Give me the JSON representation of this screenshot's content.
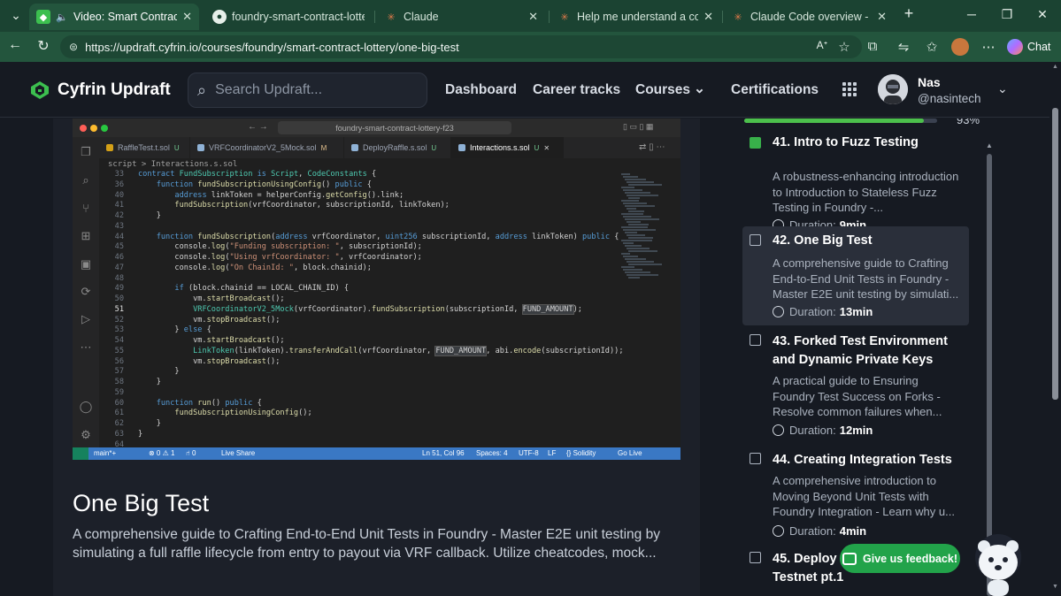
{
  "browser": {
    "tabs": [
      {
        "label": "Video: Smart Contract Lottery",
        "active": true
      },
      {
        "label": "foundry-smart-contract-lottery",
        "active": false
      },
      {
        "label": "Claude",
        "active": false
      },
      {
        "label": "Help me understand a complex",
        "active": false
      },
      {
        "label": "Claude Code overview - Claude",
        "active": false
      }
    ],
    "url": "https://updraft.cyfrin.io/courses/foundry/smart-contract-lottery/one-big-test",
    "chat_label": "Chat"
  },
  "header": {
    "logo_text": "Cyfrin Updraft",
    "search_placeholder": "Search Updraft...",
    "nav": [
      "Dashboard",
      "Career tracks",
      "Courses",
      "Certifications"
    ],
    "user": {
      "name": "Nas",
      "handle": "@nasintech"
    }
  },
  "video": {
    "search_text": "foundry-smart-contract-lottery-f23",
    "tabs": [
      {
        "label": "RaffleTest.t.sol",
        "mark": "U"
      },
      {
        "label": "VRFCoordinatorV2_5Mock.sol",
        "mark": "M"
      },
      {
        "label": "DeployRaffle.s.sol",
        "mark": "U"
      },
      {
        "label": "Interactions.s.sol",
        "mark": "U"
      }
    ],
    "breadcrumb": "script  >  Interactions.s.sol",
    "code_lines": [
      {
        "n": "33",
        "t": "contract FundSubscription is Script, CodeConstants {"
      },
      {
        "n": "36",
        "t": "    function fundSubscriptionUsingConfig() public {"
      },
      {
        "n": "40",
        "t": "        address linkToken = helperConfig.getConfig().link;"
      },
      {
        "n": "41",
        "t": "        fundSubscription(vrfCoordinator, subscriptionId, linkToken);"
      },
      {
        "n": "42",
        "t": "    }"
      },
      {
        "n": "43",
        "t": ""
      },
      {
        "n": "44",
        "t": "    function fundSubscription(address vrfCoordinator, uint256 subscriptionId, address linkToken) public {"
      },
      {
        "n": "45",
        "t": "        console.log(\"Funding subscription: \", subscriptionId);"
      },
      {
        "n": "46",
        "t": "        console.log(\"Using vrfCoordinator: \", vrfCoordinator);"
      },
      {
        "n": "47",
        "t": "        console.log(\"On ChainId: \", block.chainid);"
      },
      {
        "n": "48",
        "t": ""
      },
      {
        "n": "49",
        "t": "        if (block.chainid == LOCAL_CHAIN_ID) {"
      },
      {
        "n": "50",
        "t": "            vm.startBroadcast();"
      },
      {
        "n": "51",
        "t": "            VRFCoordinatorV2_5Mock(vrfCoordinator).fundSubscription(subscriptionId, FUND_AMOUNT);"
      },
      {
        "n": "52",
        "t": "            vm.stopBroadcast();"
      },
      {
        "n": "53",
        "t": "        } else {"
      },
      {
        "n": "54",
        "t": "            vm.startBroadcast();"
      },
      {
        "n": "55",
        "t": "            LinkToken(linkToken).transferAndCall(vrfCoordinator, FUND_AMOUNT, abi.encode(subscriptionId));"
      },
      {
        "n": "56",
        "t": "            vm.stopBroadcast();"
      },
      {
        "n": "57",
        "t": "        }"
      },
      {
        "n": "58",
        "t": "    }"
      },
      {
        "n": "59",
        "t": ""
      },
      {
        "n": "60",
        "t": "    function run() public {"
      },
      {
        "n": "61",
        "t": "        fundSubscriptionUsingConfig();"
      },
      {
        "n": "62",
        "t": "    }"
      },
      {
        "n": "63",
        "t": "}"
      },
      {
        "n": "64",
        "t": ""
      }
    ],
    "status": {
      "branch": "main*+",
      "problems": "⊗ 0 ⚠ 1",
      "ports": "⑁ 0",
      "liveshare": "Live Share",
      "position": "Ln 51, Col 96",
      "spaces": "Spaces: 4",
      "encoding": "UTF-8",
      "eol": "LF",
      "language": "{} Solidity",
      "golive": "Go Live"
    }
  },
  "lesson": {
    "title": "One Big Test",
    "description": "A comprehensive guide to Crafting End-to-End Unit Tests in Foundry - Master E2E unit testing by simulating a full raffle lifecycle from entry to payout via VRF callback. Utilize cheatcodes, mock..."
  },
  "sidebar": {
    "progress_label": "93%",
    "progress": 0.93,
    "lessons": [
      {
        "title": "41. Intro to Fuzz Testing",
        "desc": "A robustness-enhancing introduction to Introduction to Stateless Fuzz Testing in Foundry -...",
        "duration_label": "Duration:",
        "duration": "9min",
        "checked": true,
        "active": false
      },
      {
        "title": "42. One Big Test",
        "desc": "A comprehensive guide to Crafting End-to-End Unit Tests in Foundry - Master E2E unit testing by simulati...",
        "duration_label": "Duration:",
        "duration": "13min",
        "checked": false,
        "active": true
      },
      {
        "title": "43. Forked Test Environment and Dynamic Private Keys",
        "desc": "A practical guide to Ensuring Foundry Test Success on Forks - Resolve common failures when...",
        "duration_label": "Duration:",
        "duration": "12min",
        "checked": false,
        "active": false
      },
      {
        "title": "44. Creating Integration Tests",
        "desc": "A comprehensive introduction to Moving Beyond Unit Tests with Foundry Integration - Learn why u...",
        "duration_label": "Duration:",
        "duration": "4min",
        "checked": false,
        "active": false
      },
      {
        "title": "45. Deploy to Testnet pt.1",
        "desc": "",
        "duration_label": "",
        "duration": "",
        "checked": false,
        "active": false
      }
    ]
  },
  "feedback_label": "Give us feedback!",
  "colors": {
    "brand_green": "#22a34a",
    "progress": "#4cc04c",
    "tabbar": "#1b4332"
  }
}
